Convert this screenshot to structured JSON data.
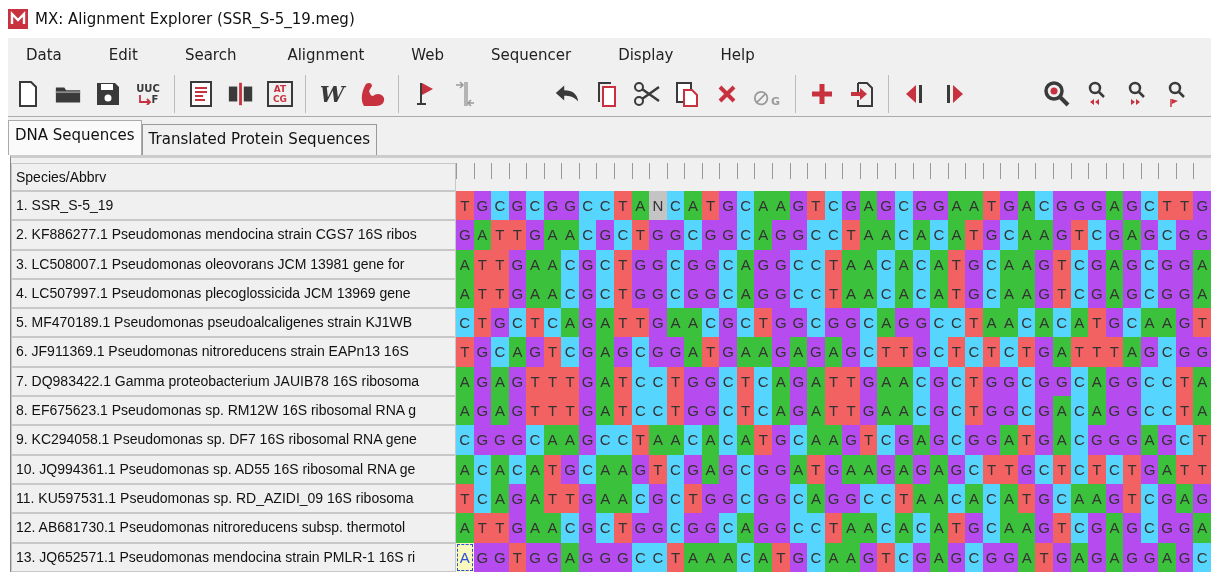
{
  "window": {
    "title": "MX: Alignment Explorer (SSR_S-5_19.meg)"
  },
  "menu": [
    "Data",
    "Edit",
    "Search",
    "Alignment",
    "Web",
    "Sequencer",
    "Display",
    "Help"
  ],
  "toolbar": [
    {
      "kind": "new",
      "disabled": false
    },
    {
      "kind": "open",
      "disabled": false
    },
    {
      "kind": "save",
      "disabled": false
    },
    {
      "kind": "translate",
      "label": "UUC",
      "label2": "F",
      "disabled": false
    },
    {
      "kind": "sep"
    },
    {
      "kind": "text",
      "disabled": false
    },
    {
      "kind": "columns",
      "disabled": false
    },
    {
      "kind": "bases",
      "label": "AT",
      "label2": "CG",
      "disabled": false
    },
    {
      "kind": "sep"
    },
    {
      "kind": "w",
      "label": "W",
      "disabled": false
    },
    {
      "kind": "arm",
      "disabled": false
    },
    {
      "kind": "sep"
    },
    {
      "kind": "flag",
      "disabled": false
    },
    {
      "kind": "gap",
      "disabled": true
    },
    {
      "kind": "space"
    },
    {
      "kind": "undo",
      "disabled": false
    },
    {
      "kind": "copy",
      "disabled": false
    },
    {
      "kind": "cut",
      "disabled": false
    },
    {
      "kind": "paste",
      "disabled": false
    },
    {
      "kind": "delete",
      "disabled": false
    },
    {
      "kind": "nogap",
      "label": "G",
      "disabled": true
    },
    {
      "kind": "sep"
    },
    {
      "kind": "add",
      "disabled": false
    },
    {
      "kind": "import",
      "disabled": false
    },
    {
      "kind": "sep"
    },
    {
      "kind": "prev",
      "disabled": false
    },
    {
      "kind": "next",
      "disabled": false
    },
    {
      "kind": "space"
    },
    {
      "kind": "search",
      "disabled": false
    },
    {
      "kind": "find-prev",
      "disabled": false
    },
    {
      "kind": "find-next",
      "disabled": false
    },
    {
      "kind": "find-mark",
      "disabled": false
    }
  ],
  "tabs": [
    {
      "label": "DNA Sequences",
      "selected": true
    },
    {
      "label": "Translated Protein Sequences",
      "selected": false
    }
  ],
  "table": {
    "header": "Species/Abbrv",
    "rows": [
      {
        "name": "1. SSR_S-5_19",
        "sequence": "T G C G C G G C C T A N C A T G C A A G T C G A G C G G A A T G A C G G G A G C T T G",
        "cursor_at_start": false
      },
      {
        "name": "2. KF886277.1 Pseudomonas mendocina strain CGS7 16S ribos",
        "sequence": "G A T T G A A C G C T G G C G G C A G G C C T A A C A C A T G C A A G T C G A G C G G",
        "cursor_at_start": false
      },
      {
        "name": "3. LC508007.1 Pseudomonas oleovorans JCM 13981 gene for",
        "sequence": "A T T G A A C G C T G G C G G C A G G C C T A A C A C A T G C A A G T C G A G C G G A",
        "cursor_at_start": false
      },
      {
        "name": "4. LC507997.1 Pseudomonas plecoglossicida JCM 13969 gene",
        "sequence": "A T T G A A C G C T G G C G G C A G G C C T A A C A C A T G C A A G T C G A G C G G A",
        "cursor_at_start": false
      },
      {
        "name": "5. MF470189.1 Pseudomonas pseudoalcaligenes strain KJ1WB",
        "sequence": "C T G C T C A G A T T G A A C G C T G G C G G C A G G C C T A A C A C A T G C A A G T",
        "cursor_at_start": false
      },
      {
        "name": "6. JF911369.1 Pseudomonas nitroreducens strain EAPn13 16S",
        "sequence": "T G C A G T C G A G C G G A T G A A G A G A G C T T G C T C T C T G A T T T A G C G G",
        "cursor_at_start": false
      },
      {
        "name": "7. DQ983422.1 Gamma proteobacterium JAUIB78 16S ribosoma",
        "sequence": "A G A G T T T G A T C C T G G C T C A G A T T G A A C G C T G G C G G C A G G C C T A",
        "cursor_at_start": false
      },
      {
        "name": "8. EF675623.1 Pseudomonas sp. RM12W 16S ribosomal RNA g",
        "sequence": "A G A G T T T G A T C C T G G C T C A G A T T G A A C G C T G G C G A C A G G C C T A",
        "cursor_at_start": false
      },
      {
        "name": "9. KC294058.1 Pseudomonas sp. DF7 16S ribosomal RNA gene",
        "sequence": "C G G G C A A G C C T A A C A C A T G C A A G T C G A G C G G A T G A C G G G A G C T",
        "cursor_at_start": false
      },
      {
        "name": "10. JQ994361.1 Pseudomonas sp. AD55 16S ribosomal RNA ge",
        "sequence": "A C A C A T G C A A G T C G A G C G G A T G A A G A G A G C T T G C T C T C T G A T T",
        "cursor_at_start": false
      },
      {
        "name": "11. KU597531.1 Pseudomonas sp. RD_AZIDI_09 16S ribosoma",
        "sequence": "T C A G A T T G A A C G C T G G C G G C A G G C C T A A C A C A T G C A A G T C G A G",
        "cursor_at_start": false
      },
      {
        "name": "12. AB681730.1 Pseudomonas nitroreducens subsp. thermotol",
        "sequence": "A T T G A A C G C T G G C G G C A G G C C T A A C A C A T G C A A G T C G A G C G G A",
        "cursor_at_start": false
      },
      {
        "name": "13. JQ652571.1 Pseudomonas mendocina strain PMLR-1 16S ri",
        "sequence": "A G G T G G A G G G C C T A A A C A T G C A A G T C G A G C G G A T G A G A G G A G C",
        "cursor_at_start": true
      }
    ]
  }
}
